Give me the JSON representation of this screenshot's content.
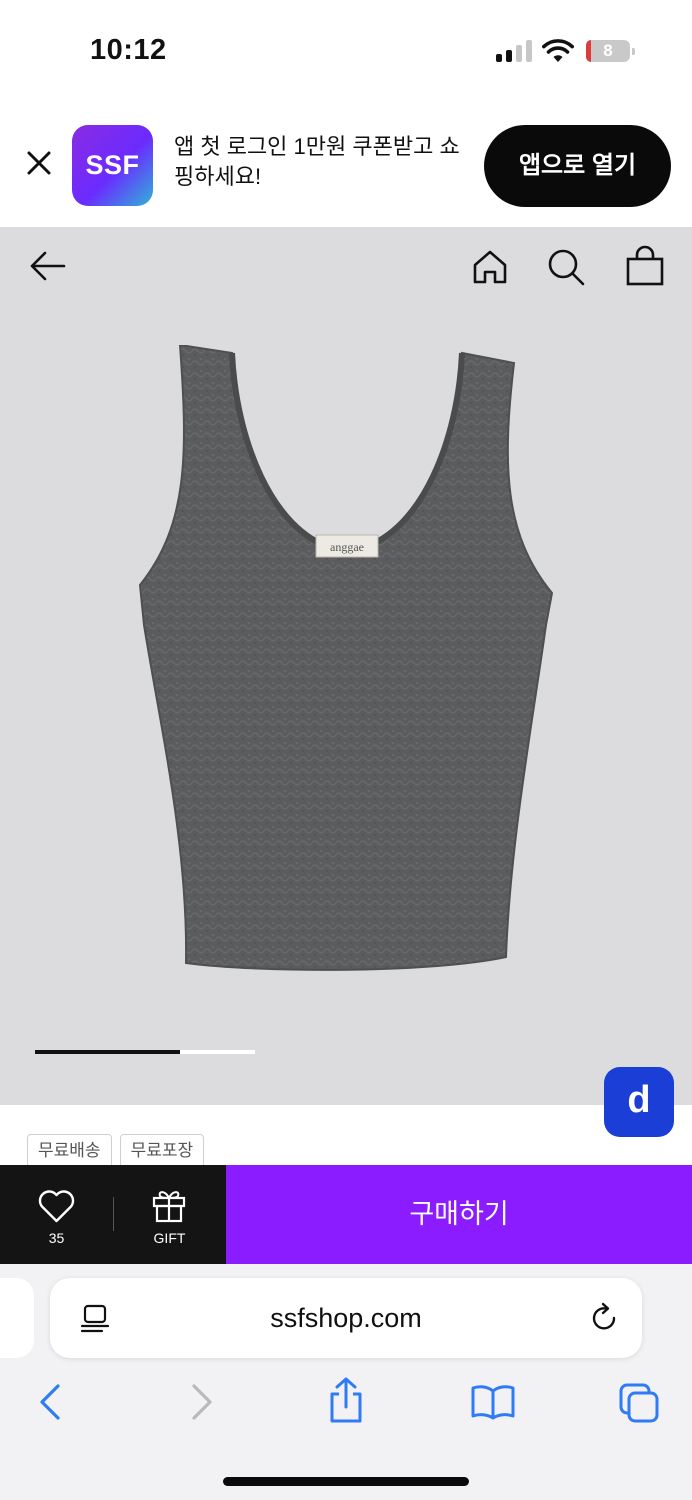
{
  "status_bar": {
    "time": "10:12",
    "battery_level": "8",
    "signal_bars_active": 2
  },
  "app_banner": {
    "logo_text": "SSF",
    "message": "앱 첫 로그인 1만원 쿠폰받고 쇼핑하세요!",
    "open_app_label": "앱으로 열기",
    "logo_gradient": [
      "#8a2be2",
      "#2fb3d9"
    ]
  },
  "product_nav": {
    "icons": [
      "back-arrow-icon",
      "home-icon",
      "search-icon",
      "shopping-bag-icon"
    ]
  },
  "product_image": {
    "brand_label": "anggae",
    "background_color": "#dcdcde",
    "slide_progress": 0.66
  },
  "floating_badge": {
    "text": "d",
    "color": "#1b3fd6"
  },
  "tags": [
    "무료배송",
    "무료포장"
  ],
  "buy_bar": {
    "like_count": "35",
    "gift_label": "GIFT",
    "buy_label": "구매하기",
    "accent_color": "#8a1cff"
  },
  "browser": {
    "url": "ssfshop.com",
    "icons": [
      "reader-icon",
      "reload-icon",
      "back-icon",
      "forward-icon",
      "share-icon",
      "bookmarks-icon",
      "tabs-icon"
    ]
  }
}
